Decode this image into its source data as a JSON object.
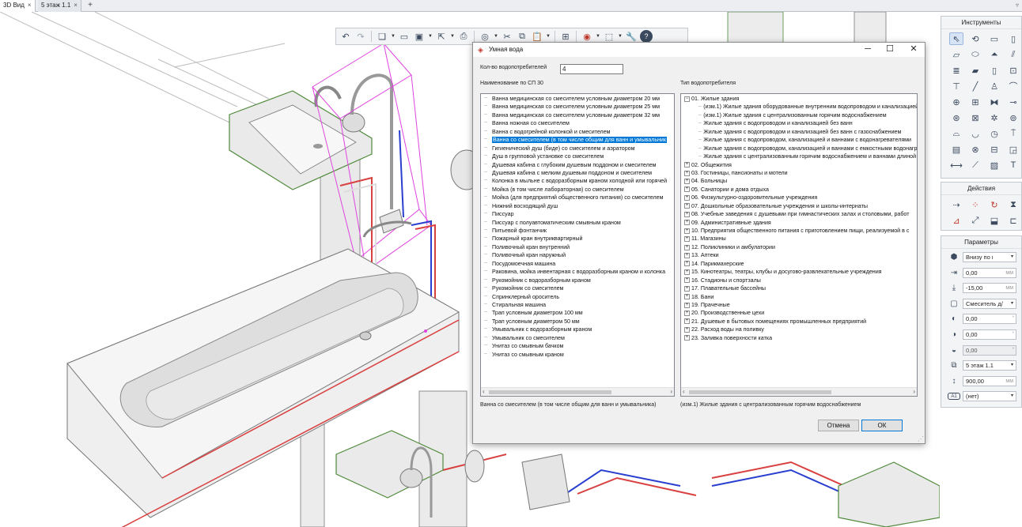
{
  "tabs": [
    {
      "label": "3D Вид",
      "close": "×"
    },
    {
      "label": "5 этаж 1.1",
      "close": "×"
    }
  ],
  "tab_add": "+",
  "tab_menu": "▿",
  "toolbar": {
    "icons": [
      "undo-icon",
      "redo-icon",
      "layers-icon",
      "window-icon",
      "save-icon",
      "export-icon",
      "print-icon",
      "render-icon",
      "cut-icon",
      "copy-icon",
      "paste-icon",
      "hierarchy-icon",
      "eye-icon",
      "view-cube-icon",
      "wrench-icon",
      "help-icon"
    ]
  },
  "dialog": {
    "title": "Умная вода",
    "minimize": "─",
    "maximize": "☐",
    "close": "✕",
    "count_label": "Кол-во водопотребителей",
    "count_value": "4",
    "left_header": "Наименование по СП 30",
    "right_header": "Тип водопотребителя",
    "left_items": [
      "Ванна медицинская со смесителем условным диаметром 20 мм",
      "Ванна медицинская со смесителем условным диаметром 25 мм",
      "Ванна медицинская со смесителем условным диаметром 32 мм",
      "Ванна ножная со смесителем",
      "Ванна с водогрейной колонкой и смесителем",
      "Ванна со смесителем (в том числе общим для ванн и умывальник",
      "Гигиенический душ (биде) со смесителем и аэратором",
      "Душ в групповой установке со смесителем",
      "Душевая кабина с глубоким душевым поддоном и смесителем",
      "Душевая кабина с мелким душевым поддоном и смесителем",
      "Колонка в мыльне с водоразборным краном холодной или горячей",
      "Мойка (в том числе лабораторная) со смесителем",
      "Мойка (для предприятий общественного питания) со смесителем",
      "Нижний восходящий душ",
      "Писсуар",
      "Писсуар с полуавтоматическим смывным краном",
      "Питьевой фонтанчик",
      "Пожарный кран внутриквартирный",
      "Поливочный кран внутренний",
      "Поливочный кран наружный",
      "Посудомоечная машина",
      "Раковина, мойка инвентарная с водоразборным краном и колонка",
      "Рукомойник с водоразборным краном",
      "Рукомойник со смесителем",
      "Спринклерный ороситель",
      "Стиральная машина",
      "Трап условным диаметром 100 мм",
      "Трап условным диаметром 50 мм",
      "Умывальник с водоразборным краном",
      "Умывальник со смесителем",
      "Унитаз со смывным бачком",
      "Унитаз со смывным краном"
    ],
    "left_selected_index": 5,
    "right_items": [
      {
        "text": "01. Жилые здания",
        "level": 0,
        "exp": "−"
      },
      {
        "text": "(изм.1) Жилые здания оборудованные внутренним водопроводом и канализацией",
        "level": 1,
        "exp": ""
      },
      {
        "text": "(изм.1) Жилые здания с централизованным горячим водоснабжением",
        "level": 1,
        "exp": ""
      },
      {
        "text": "Жилые здания с водопроводом и канализацией без ванн",
        "level": 1,
        "exp": ""
      },
      {
        "text": "Жилые здания с водопроводом и канализацией без ванн с газоснабжением",
        "level": 1,
        "exp": ""
      },
      {
        "text": "Жилые здания с водопроводом, канализацией и ваннами с водонагревателями",
        "level": 1,
        "exp": ""
      },
      {
        "text": "Жилые здания с водопроводом, канализацией и ваннами с емкостными водонагревателями",
        "level": 1,
        "exp": ""
      },
      {
        "text": "Жилые здания с централизованным горячим водоснабжением и ваннами длиной",
        "level": 1,
        "exp": ""
      },
      {
        "text": "02. Общежития",
        "level": 0,
        "exp": "+"
      },
      {
        "text": "03. Гостиницы, пансионаты и мотели",
        "level": 0,
        "exp": "+"
      },
      {
        "text": "04. Больницы",
        "level": 0,
        "exp": "+"
      },
      {
        "text": "05. Санатории и дома отдыха",
        "level": 0,
        "exp": "+"
      },
      {
        "text": "06. Физкультурно-оздоровительные учреждения",
        "level": 0,
        "exp": "+"
      },
      {
        "text": "07. Дошкольные образовательные учреждения и школы-интернаты",
        "level": 0,
        "exp": "+"
      },
      {
        "text": "08. Учебные заведения с душевыми при гимнастических залах и столовыми, работ",
        "level": 0,
        "exp": "+"
      },
      {
        "text": "09. Административные здания",
        "level": 0,
        "exp": "+"
      },
      {
        "text": "10. Предприятия общественного питания с приготовлением пищи, реализуемой в с",
        "level": 0,
        "exp": "+"
      },
      {
        "text": "11. Магазины",
        "level": 0,
        "exp": "+"
      },
      {
        "text": "12. Поликлиники и амбулатории",
        "level": 0,
        "exp": "+"
      },
      {
        "text": "13. Аптеки",
        "level": 0,
        "exp": "+"
      },
      {
        "text": "14. Парикмахерские",
        "level": 0,
        "exp": "+"
      },
      {
        "text": "15. Кинотеатры, театры, клубы и досугово-развлекательные учреждения",
        "level": 0,
        "exp": "+"
      },
      {
        "text": "16. Стадионы и спортзалы",
        "level": 0,
        "exp": "+"
      },
      {
        "text": "17. Плавательные бассейны",
        "level": 0,
        "exp": "+"
      },
      {
        "text": "18. Бани",
        "level": 0,
        "exp": "+"
      },
      {
        "text": "19. Прачечные",
        "level": 0,
        "exp": "+"
      },
      {
        "text": "20. Производственные цехи",
        "level": 0,
        "exp": "+"
      },
      {
        "text": "21. Душевые в бытовых помещениях промышленных предприятий",
        "level": 0,
        "exp": "+"
      },
      {
        "text": "22. Расход воды на поливку",
        "level": 0,
        "exp": "+"
      },
      {
        "text": "23. Заливка поверхности катка",
        "level": 0,
        "exp": "+"
      }
    ],
    "left_status": "Ванна со смесителем (в том числе общим для ванн и умывальника)",
    "right_status": "(изм.1) Жилые здания с централизованным горячим водоснабжением",
    "cancel_label": "Отмена",
    "ok_label": "ОК"
  },
  "panels": {
    "tools_title": "Инструменты",
    "tools_icons": [
      "cursor-icon",
      "orbit-icon",
      "box-icon",
      "column-icon",
      "slab-icon",
      "beam-icon",
      "roof-icon",
      "railing-icon",
      "stair-icon",
      "panel-icon",
      "door-icon",
      "window-icon",
      "table-icon",
      "line-icon",
      "figure-icon",
      "pipe-icon",
      "plumbing-icon",
      "equipment-icon",
      "valve-icon",
      "fitting-icon",
      "radiator-icon",
      "grid-icon",
      "sprinkler-icon",
      "pump-icon",
      "toilet-icon",
      "sink-icon",
      "meter-icon",
      "tap-icon",
      "cabinet-icon",
      "fixture-icon",
      "label-icon",
      "tag-icon",
      "dimension-icon",
      "slope-icon",
      "hatch-icon",
      "text-icon"
    ],
    "actions_title": "Действия",
    "actions_icons": [
      "move-icon",
      "array-icon",
      "rotate-icon",
      "mirror-icon",
      "extend-icon",
      "resize-icon",
      "align-icon",
      "trim-icon"
    ],
    "params_title": "Параметры",
    "params": [
      {
        "icon": "anchor-icon",
        "value": "Внизу по ι",
        "unit": "",
        "ctl": "▾",
        "dis": false
      },
      {
        "icon": "offset-x-icon",
        "value": "0,00",
        "unit": "мм",
        "ctl": "",
        "dis": false
      },
      {
        "icon": "offset-y-icon",
        "value": "-15,00",
        "unit": "мм",
        "ctl": "",
        "dis": false
      },
      {
        "icon": "mixer-icon",
        "value": "Смеситель д/",
        "unit": "",
        "ctl": "▾",
        "dis": false
      },
      {
        "icon": "rotation-icon",
        "value": "0,00",
        "unit": "",
        "ctl": "°",
        "dis": false
      },
      {
        "icon": "tilt-icon",
        "value": "0,00",
        "unit": "",
        "ctl": "°",
        "dis": false
      },
      {
        "icon": "roll-icon",
        "value": "0,00",
        "unit": "",
        "ctl": "°",
        "dis": true
      },
      {
        "icon": "floor-icon",
        "value": "5 этаж 1.1",
        "unit": "",
        "ctl": "▾",
        "dis": false
      },
      {
        "icon": "height-icon",
        "value": "900,00",
        "unit": "мм",
        "ctl": "",
        "dis": false
      },
      {
        "icon": "text-style-icon",
        "value": "(нет)",
        "unit": "",
        "ctl": "▾",
        "dis": false
      }
    ]
  }
}
